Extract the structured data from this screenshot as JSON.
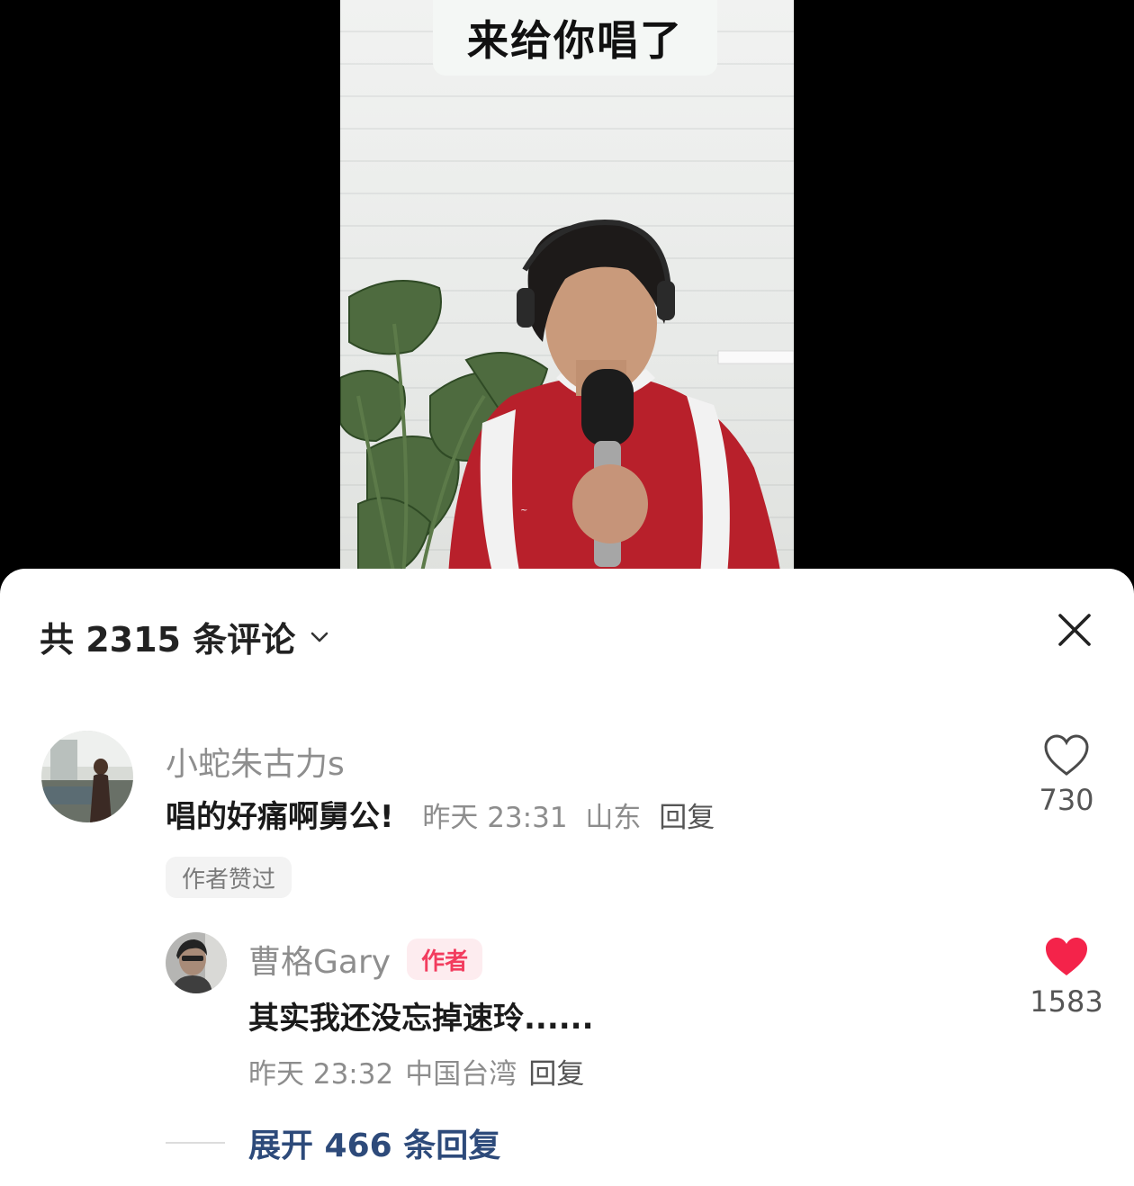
{
  "video": {
    "caption": "来给你唱了"
  },
  "comments_panel": {
    "count_label": "共 2315 条评论",
    "close_icon": "close-icon",
    "chevron_icon": "chevron-down-icon"
  },
  "comment": {
    "username": "小蛇朱古力s",
    "text": "唱的好痛啊舅公!",
    "time": "昨天 23:31",
    "location": "山东",
    "reply_label": "回复",
    "likes": "730",
    "liked_by_author_badge": "作者赞过"
  },
  "reply": {
    "username": "曹格Gary",
    "author_tag": "作者",
    "text": "其实我还没忘掉速玲......",
    "time": "昨天 23:32",
    "location": "中国台湾",
    "reply_label": "回复",
    "likes": "1583",
    "heart_color": "#f4234a"
  },
  "expand": {
    "label": "展开 466 条回复"
  }
}
